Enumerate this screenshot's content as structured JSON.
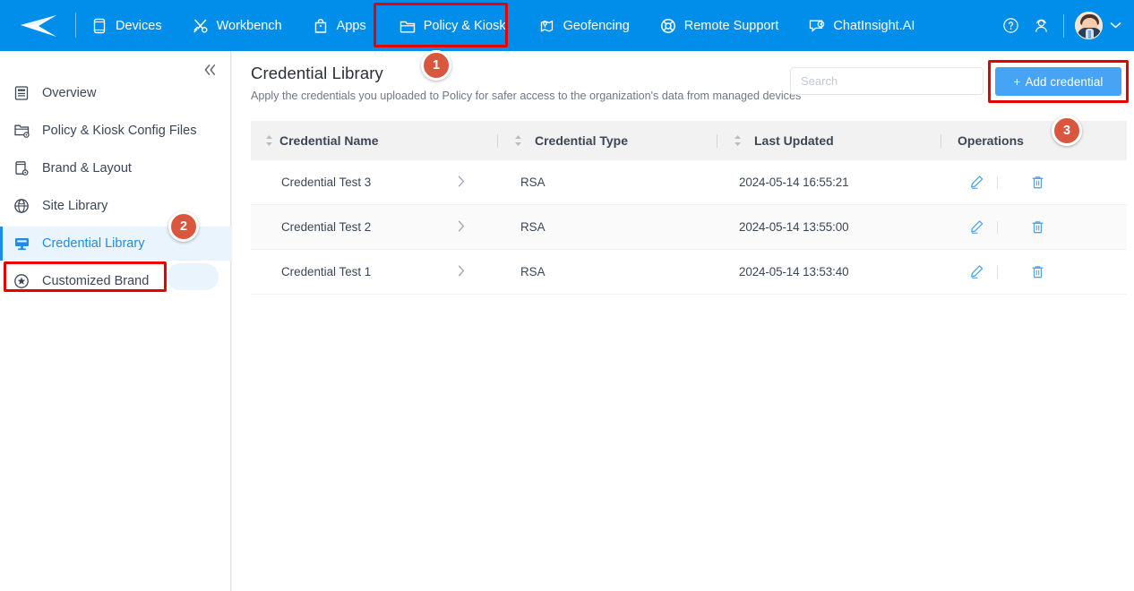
{
  "topnav": {
    "logo_icon": "paper-plane-logo",
    "items": [
      {
        "label": "Devices",
        "icon": "phone-icon",
        "active": false
      },
      {
        "label": "Workbench",
        "icon": "tools-icon",
        "active": false
      },
      {
        "label": "Apps",
        "icon": "bag-icon",
        "active": false
      },
      {
        "label": "Policy & Kiosk",
        "icon": "folder-icon",
        "active": true
      },
      {
        "label": "Geofencing",
        "icon": "map-pin-icon",
        "active": false
      },
      {
        "label": "Remote Support",
        "icon": "lifebuoy-icon",
        "active": false
      },
      {
        "label": "ChatInsight.AI",
        "icon": "chat-target-icon",
        "active": false
      }
    ],
    "help_icon": "question-circle-icon",
    "support_icon": "headset-user-icon",
    "avatar_icon": "user-avatar",
    "chevron_icon": "chevron-down-icon",
    "background_color": "#008EEA"
  },
  "sidebar": {
    "collapse_icon": "double-chevron-left-icon",
    "items": [
      {
        "label": "Overview",
        "icon": "document-list-icon",
        "active": false
      },
      {
        "label": "Policy & Kiosk Config Files",
        "icon": "folder-gear-icon",
        "active": false
      },
      {
        "label": "Brand & Layout",
        "icon": "device-gear-icon",
        "active": false
      },
      {
        "label": "Site Library",
        "icon": "globe-icon",
        "active": false
      },
      {
        "label": "Credential Library",
        "icon": "monitor-icon",
        "active": true
      },
      {
        "label": "Customized Brand",
        "icon": "star-circle-icon",
        "active": false
      }
    ],
    "active_color": "#1f8ce8"
  },
  "main": {
    "title": "Credential Library",
    "subtitle": "Apply the credentials you uploaded to Policy for safer access to the organization's data from managed devices",
    "search": {
      "placeholder": "Search",
      "value": ""
    },
    "add_button": {
      "label": "Add credential",
      "plus_icon": "plus-icon",
      "color": "#47A3F3"
    }
  },
  "table": {
    "columns": [
      {
        "label": "Credential Name",
        "sortable": true
      },
      {
        "label": "Credential Type",
        "sortable": true
      },
      {
        "label": "Last Updated",
        "sortable": true
      },
      {
        "label": "Operations",
        "sortable": false
      }
    ],
    "rows": [
      {
        "name": "Credential Test 3",
        "expand_icon": "chevron-right-icon",
        "type": "RSA",
        "updated": "2024-05-14 16:55:21",
        "edit_icon": "pencil-icon",
        "delete_icon": "trash-icon"
      },
      {
        "name": "Credential Test 2",
        "expand_icon": "chevron-right-icon",
        "type": "RSA",
        "updated": "2024-05-14 13:55:00",
        "edit_icon": "pencil-icon",
        "delete_icon": "trash-icon"
      },
      {
        "name": "Credential Test 1",
        "expand_icon": "chevron-right-icon",
        "type": "RSA",
        "updated": "2024-05-14 13:53:40",
        "edit_icon": "pencil-icon",
        "delete_icon": "trash-icon"
      }
    ]
  },
  "annotations": {
    "badge_color": "#D9573F",
    "highlight_color": "#E60000",
    "steps": [
      {
        "id": "1",
        "label": "1",
        "target": "Policy & Kiosk"
      },
      {
        "id": "2",
        "label": "2",
        "target": "Credential Library"
      },
      {
        "id": "3",
        "label": "3",
        "target": "Add credential"
      }
    ]
  }
}
